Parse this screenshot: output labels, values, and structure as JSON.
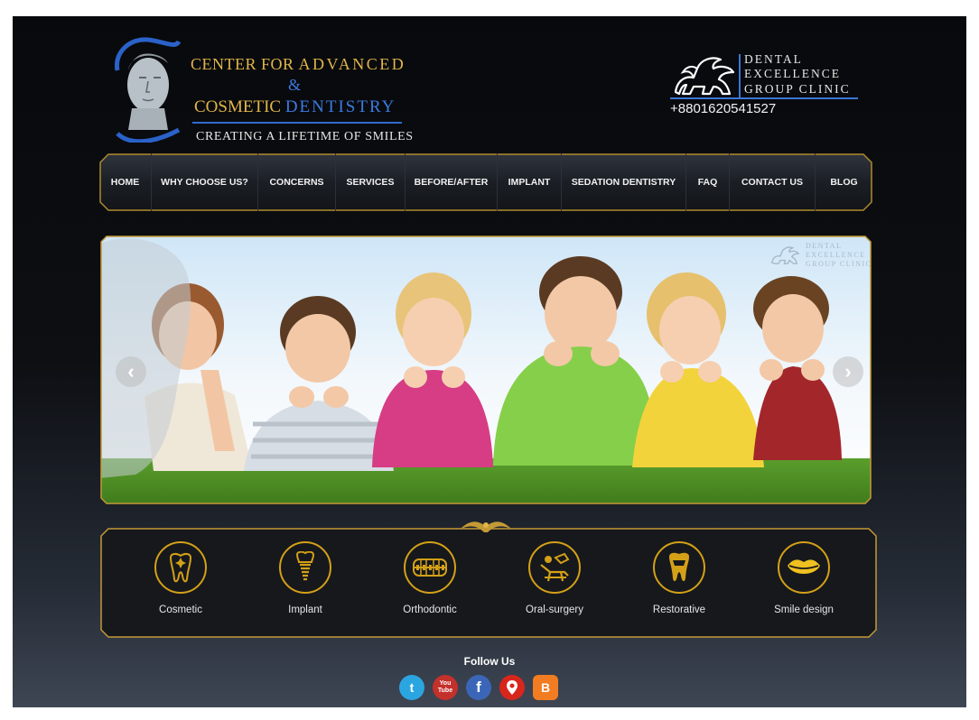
{
  "brand": {
    "line1_a": "CENTER FOR ",
    "line1_b": "ADVANCED",
    "amp": "&",
    "line2_a": "COSMETIC ",
    "line2_b": "DENTISTRY",
    "tagline": "CREATING A LIFETIME OF SMILES",
    "bust_icon": "greek-bust-icon"
  },
  "partner": {
    "line1": "DENTAL",
    "line2": "EXCELLENCE",
    "line3": "GROUP CLINIC",
    "phone": "+8801620541527",
    "icon": "griffin-icon"
  },
  "nav": {
    "items": [
      "HOME",
      "WHY CHOOSE US?",
      "CONCERNS",
      "SERVICES",
      "BEFORE/AFTER",
      "IMPLANT",
      "SEDATION DENTISTRY",
      "FAQ",
      "CONTACT US",
      "BLOG"
    ]
  },
  "slider": {
    "prev_icon": "chevron-left-icon",
    "next_icon": "chevron-right-icon",
    "watermark": [
      "DENTAL",
      "EXCELLENCE",
      "GROUP CLINIC"
    ]
  },
  "services": [
    {
      "label": "Cosmetic",
      "icon": "tooth-sparkle-icon"
    },
    {
      "label": "Implant",
      "icon": "dental-implant-icon"
    },
    {
      "label": "Orthodontic",
      "icon": "braces-icon"
    },
    {
      "label": "Oral-surgery",
      "icon": "dental-chair-icon"
    },
    {
      "label": "Restorative",
      "icon": "crown-tooth-icon"
    },
    {
      "label": "Smile design",
      "icon": "lips-icon"
    }
  ],
  "follow": {
    "title": "Follow Us",
    "networks": [
      {
        "name": "twitter",
        "glyph": "t",
        "color": "#2ba5e0"
      },
      {
        "name": "youtube",
        "glyph": "You Tube",
        "color": "#c4302b"
      },
      {
        "name": "facebook",
        "glyph": "f",
        "color": "#3b66b8"
      },
      {
        "name": "maps",
        "glyph": "",
        "color": "#d8261c"
      },
      {
        "name": "blogger",
        "glyph": "B",
        "color": "#f27c21"
      }
    ]
  },
  "colors": {
    "gold": "#d4a017",
    "blue": "#3b7be0",
    "background": "#0d0f13"
  }
}
